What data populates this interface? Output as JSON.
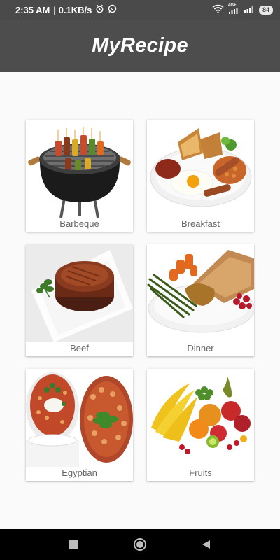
{
  "status_bar": {
    "time": "2:35 AM",
    "speed": "| 0.1KB/s",
    "network": "4G+",
    "battery": "84"
  },
  "app": {
    "title": "MyRecipe"
  },
  "categories": [
    {
      "label": "Barbeque",
      "image": "barbeque-grill-image"
    },
    {
      "label": "Breakfast",
      "image": "breakfast-plate-image"
    },
    {
      "label": "Beef",
      "image": "beef-steak-image"
    },
    {
      "label": "Dinner",
      "image": "dinner-plate-image"
    },
    {
      "label": "Egyptian",
      "image": "egyptian-soup-image"
    },
    {
      "label": "Fruits",
      "image": "fruits-image"
    }
  ],
  "nav_bar": {
    "icons": [
      "recent-apps-icon",
      "home-icon",
      "back-icon"
    ]
  }
}
